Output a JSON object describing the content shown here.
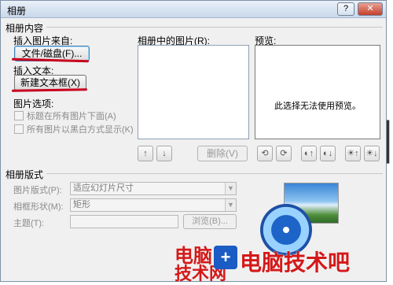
{
  "window": {
    "title": "相册",
    "help_glyph": "?",
    "close_glyph": "✕"
  },
  "album_content": {
    "section_title": "相册内容",
    "insert_picture_from": "插入图片来自:",
    "file_disk_button": "文件/磁盘(F)...",
    "insert_text": "插入文本:",
    "new_textbox_button": "新建文本框(X)",
    "picture_options": "图片选项:",
    "option_captions": "标题在所有图片下面(A)",
    "option_black_white": "所有图片以黑白方式显示(K)",
    "pictures_in_album_label": "相册中的图片(R):",
    "preview_label": "预览:",
    "preview_message": "此选择无法使用预览。",
    "move_up_glyph": "↑",
    "move_down_glyph": "↓",
    "remove_button": "删除(V)",
    "rotate_left_glyph": "⟲",
    "rotate_right_glyph": "⟳",
    "contrast_up_glyph": "◐↑",
    "contrast_down_glyph": "◐↓",
    "bright_up_glyph": "☀↑",
    "bright_down_glyph": "☀↓"
  },
  "album_layout": {
    "section_title": "相册版式",
    "picture_layout_label": "图片版式(P):",
    "picture_layout_value": "适应幻灯片尺寸",
    "frame_shape_label": "相框形状(M):",
    "frame_shape_value": "矩形",
    "theme_label": "主题(T):",
    "browse_button": "浏览(B)..."
  },
  "watermark": {
    "logo_line1": "电脑",
    "logo_line2": "技术网",
    "site_name": "电脑技术吧",
    "shield_glyph": "+"
  },
  "background_glyph": "相",
  "colors": {
    "annotation_red": "#c8001e",
    "watermark_red": "#d41818"
  }
}
